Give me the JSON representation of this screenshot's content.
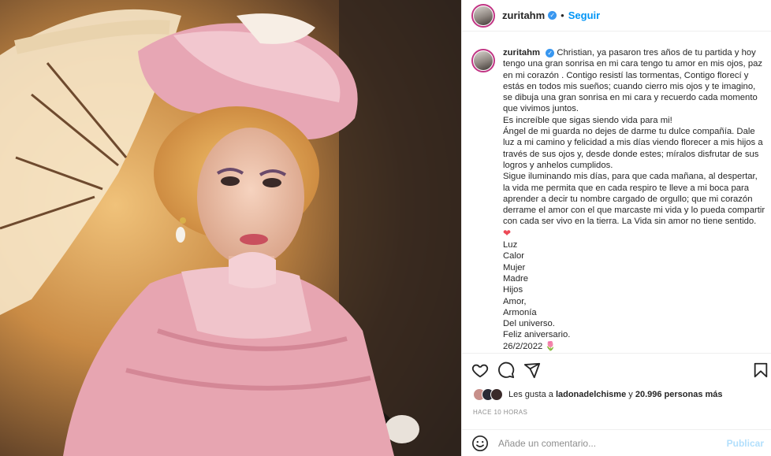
{
  "header": {
    "username": "zuritahm",
    "verified_mark": "✓",
    "dot": "•",
    "follow_label": "Seguir"
  },
  "caption": {
    "username": "zuritahm",
    "lines": [
      "Christian, ya pasaron tres años de tu partida y hoy tengo una gran sonrisa en mi cara tengo tu amor en mis ojos, paz en mi corazón . Contigo resistí las tormentas, Contigo florecí y estás en todos mis sueños; cuando cierro mis ojos y te imagino, se dibuja una gran sonrisa en mi cara y recuerdo cada momento que vivimos juntos.",
      "Es increíble que sigas siendo vida para mi!",
      "Ángel de mi guarda no dejes de darme tu dulce compañía. Dale luz a mi camino y felicidad a mis días viendo florecer a mis hijos a través de sus ojos y, desde donde estes; míralos disfrutar de sus logros y anhelos cumplidos.",
      "Sigue iluminando mis días, para que cada mañana, al despertar, la vida me permita que en cada respiro te lleve a mi boca para aprender a decir tu nombre cargado de orgullo; que mi corazón derrame el amor con el que marcaste mi vida y lo pueda compartir con cada ser vivo en la tierra. La Vida sin amor no tiene sentido."
    ],
    "heart": "❤",
    "words": [
      "Luz",
      "Calor",
      "Mujer",
      "Madre",
      "Hijos",
      "Amor,",
      "Armonía",
      "Del universo.",
      "Feliz aniversario."
    ],
    "date": "26/2/2022",
    "tulip": "🌷"
  },
  "actions": {
    "icons": [
      "heart-icon",
      "comment-icon",
      "share-icon",
      "bookmark-icon"
    ]
  },
  "likes": {
    "prefix": "Les gusta a",
    "user": "ladonadelchisme",
    "connector": "y",
    "count": "20.996 personas más"
  },
  "time": "HACE 10 HORAS",
  "add_comment": {
    "placeholder": "Añade un comentario...",
    "publish_label": "Publicar"
  },
  "colors": {
    "accent": "#0095f6",
    "verified": "#3897f0",
    "heart": "#ed4956"
  }
}
